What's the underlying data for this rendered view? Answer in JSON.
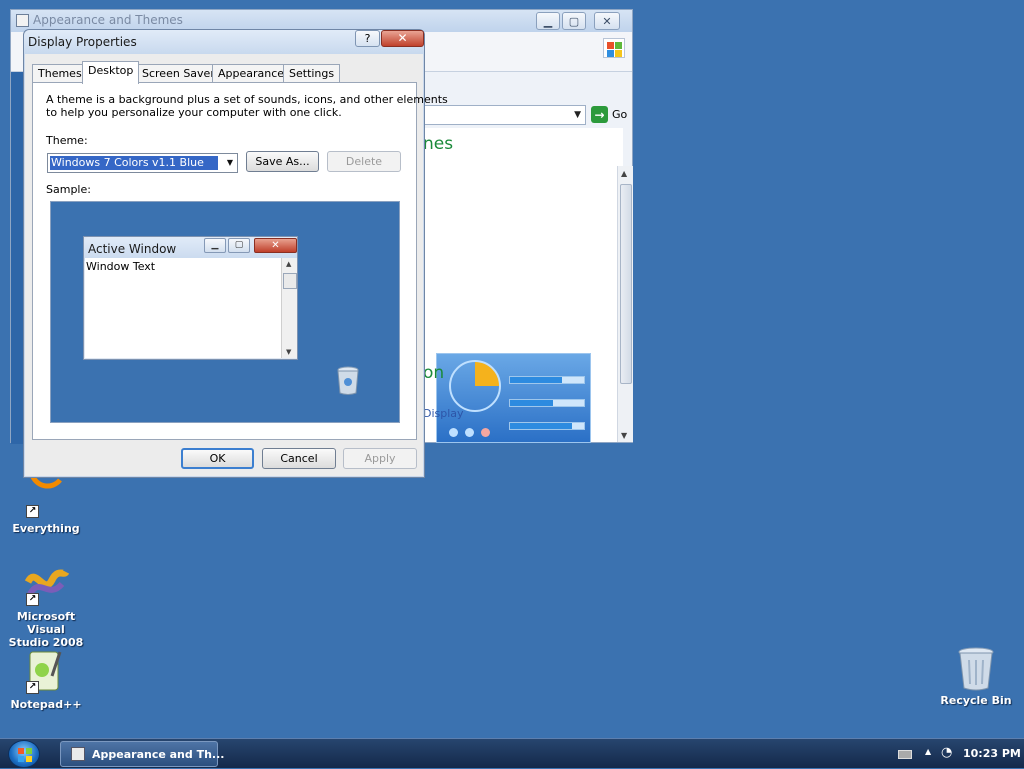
{
  "background_window": {
    "title": "Appearance and Themes",
    "go_label": "Go",
    "fragment_heading": "nes",
    "fragment_subheading": "on",
    "fragment_link": "Display"
  },
  "dialog": {
    "title": "Display Properties",
    "help_label": "?",
    "close_label": "✕",
    "tabs": [
      {
        "label": "Themes"
      },
      {
        "label": "Desktop"
      },
      {
        "label": "Screen Saver"
      },
      {
        "label": "Appearance"
      },
      {
        "label": "Settings"
      }
    ],
    "active_tab": "Desktop",
    "description_line1": "A theme is a background plus a set of sounds, icons, and other elements",
    "description_line2": "to help you personalize your computer with one click.",
    "theme_label": "Theme:",
    "theme_value": "Windows 7 Colors v1.1 Blue",
    "save_as_label": "Save As...",
    "delete_label": "Delete",
    "sample_label": "Sample:",
    "sample": {
      "window_title": "Active Window",
      "window_text": "Window Text"
    },
    "ok_label": "OK",
    "cancel_label": "Cancel",
    "apply_label": "Apply"
  },
  "desktop_icons": [
    {
      "label": "Everything"
    },
    {
      "label_line1": "Microsoft Visual",
      "label_line2": "Studio 2008"
    },
    {
      "label": "Notepad++"
    },
    {
      "label": "Recycle Bin"
    }
  ],
  "taskbar": {
    "task_label": "Appearance and Th...",
    "clock": "10:23 PM"
  },
  "colors": {
    "desktop": "#3b72b0",
    "selection": "#3567c6",
    "close_red": "#c0412b",
    "link_green": "#1a8a3a"
  }
}
